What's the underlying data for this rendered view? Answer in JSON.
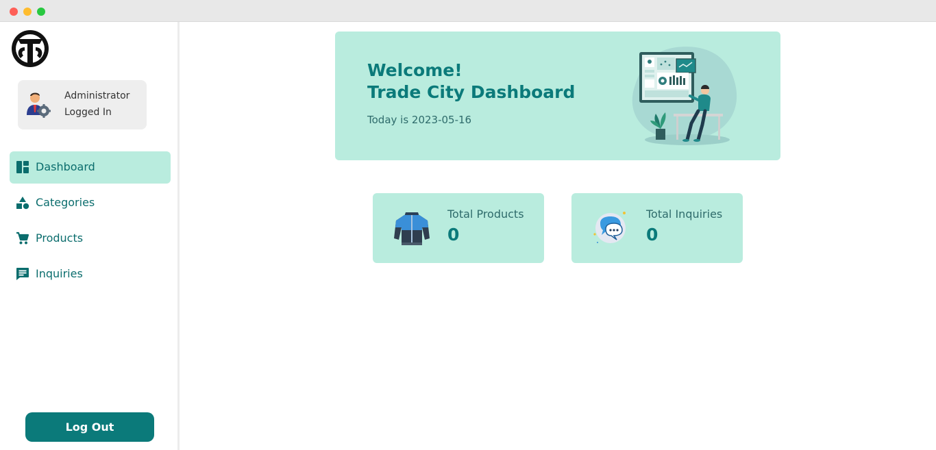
{
  "user": {
    "role": "Administrator",
    "status": "Logged In"
  },
  "nav": {
    "items": [
      {
        "label": "Dashboard",
        "icon": "dashboard-icon",
        "active": true
      },
      {
        "label": "Categories",
        "icon": "categories-icon",
        "active": false
      },
      {
        "label": "Products",
        "icon": "cart-icon",
        "active": false
      },
      {
        "label": "Inquiries",
        "icon": "chat-icon",
        "active": false
      }
    ]
  },
  "logout_label": "Log Out",
  "banner": {
    "welcome": "Welcome!",
    "title": "Trade City Dashboard",
    "date_text": "Today is 2023-05-16"
  },
  "stats": {
    "products": {
      "label": "Total Products",
      "value": "0",
      "icon": "jacket-icon"
    },
    "inquiries": {
      "label": "Total Inquiries",
      "value": "0",
      "icon": "speech-bubble-icon"
    }
  },
  "colors": {
    "accent": "#0b7a7a",
    "accent_light": "#b9ecde",
    "sidebar_card": "#eeeeee"
  }
}
